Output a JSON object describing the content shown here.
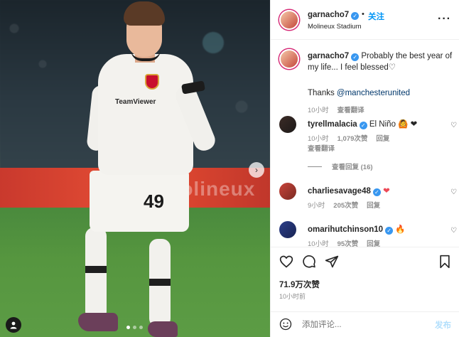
{
  "post": {
    "slide_current": 1,
    "slide_total": 3,
    "next_icon": "chevron-right-icon",
    "tag_icon": "user-tag-icon",
    "jersey_sponsor": "TeamViewer",
    "jersey_number": "49"
  },
  "header": {
    "username": "garnacho7",
    "separator": "•",
    "follow_label": "关注",
    "location": "Molineux Stadium",
    "more_label": "···"
  },
  "caption": {
    "username": "garnacho7",
    "text": "Probably the best year of my life... I feel blessed♡",
    "thanks_prefix": "Thanks ",
    "thanks_mention": "@manchesterunited",
    "time": "10小时",
    "translate": "查看翻译"
  },
  "comments": [
    {
      "username": "tyrellmalacia",
      "text": "El Niño 🙆 ❤",
      "time": "10小时",
      "likes": "1,079次赞",
      "reply": "回复",
      "translate": "查看翻译",
      "view_replies": "查看回复 (16)"
    },
    {
      "username": "charliesavage48",
      "text": "❤",
      "time": "9小时",
      "likes": "205次赞",
      "reply": "回复"
    },
    {
      "username": "omarihutchinson10",
      "text": "🔥",
      "time": "10小时",
      "likes": "95次赞",
      "reply": "回复"
    }
  ],
  "actions": {
    "like_icon": "heart-icon",
    "comment_icon": "comment-icon",
    "share_icon": "send-icon",
    "save_icon": "bookmark-icon",
    "likes": "71.9万次赞",
    "posted": "10小时前"
  },
  "composer": {
    "emoji_icon": "emoji-icon",
    "placeholder": "添加评论...",
    "post_label": "发布"
  },
  "colors": {
    "accent": "#0095f6",
    "verified": "#3897f0",
    "heart": "#ed4956"
  }
}
